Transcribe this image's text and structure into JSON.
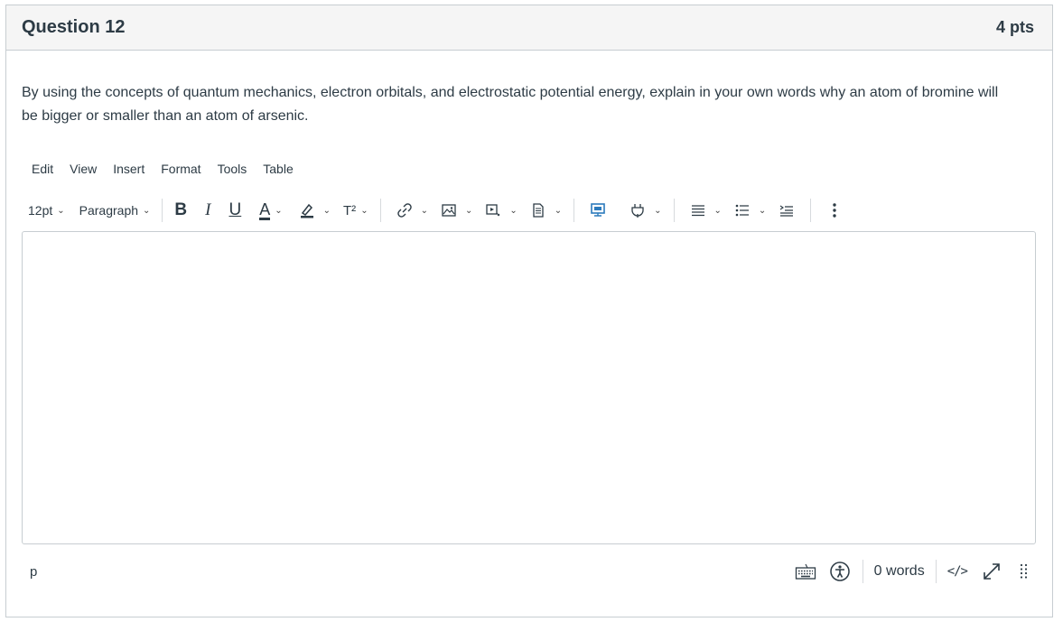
{
  "question": {
    "title": "Question 12",
    "points": "4 pts",
    "text": "By using the concepts of quantum mechanics, electron orbitals, and electrostatic potential energy, explain in your own words why an atom of bromine will be bigger or smaller than an atom of arsenic."
  },
  "menubar": {
    "items": [
      "Edit",
      "View",
      "Insert",
      "Format",
      "Tools",
      "Table"
    ]
  },
  "toolbar": {
    "font_size": "12pt",
    "block_format": "Paragraph",
    "bold": "B",
    "italic": "I",
    "underline": "U",
    "text_color": "A",
    "superscript": "T²",
    "icons": [
      "link-icon",
      "image-icon",
      "media-icon",
      "document-icon",
      "embed-icon",
      "apps-plug-icon",
      "align-icon",
      "list-icon",
      "indent-icon",
      "more-vertical-icon"
    ]
  },
  "editor": {
    "content": ""
  },
  "statusbar": {
    "path": "p",
    "word_count": "0 words",
    "html_toggle": "</>"
  },
  "colors": {
    "border": "#c7cdd1",
    "header_bg": "#f5f5f5",
    "text": "#2d3b45",
    "accent_blue": "#2b7abc"
  }
}
